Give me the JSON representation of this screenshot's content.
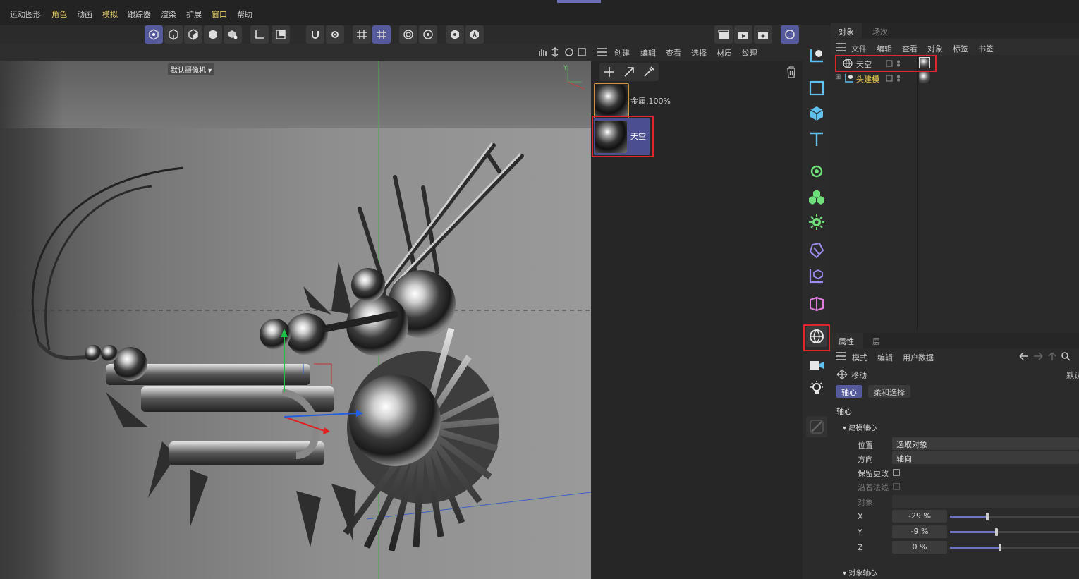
{
  "menu": [
    "运动图形",
    "角色",
    "动画",
    "模拟",
    "跟踪器",
    "渲染",
    "扩展",
    "窗口",
    "帮助"
  ],
  "viewport": {
    "camera_label": "默认摄像机",
    "axis_y": "Y"
  },
  "material_panel": {
    "menu": [
      "创建",
      "编辑",
      "查看",
      "选择",
      "材质",
      "纹理"
    ],
    "materials": [
      {
        "name": "金属.100%"
      },
      {
        "name": "天空",
        "selected": true
      }
    ]
  },
  "object_panel": {
    "tabs": [
      "对象",
      "场次"
    ],
    "menu": [
      "文件",
      "编辑",
      "查看",
      "对象",
      "标签",
      "书签"
    ],
    "objects": [
      {
        "name": "天空",
        "color": "#c9c9c9"
      },
      {
        "name": "头建模",
        "color": "#e8c24a"
      }
    ]
  },
  "attribute_panel": {
    "tabs": [
      "属性",
      "层"
    ],
    "menu": [
      "模式",
      "编辑",
      "用户数据"
    ],
    "tool_name": "移动",
    "right_label": "默认",
    "subtabs": [
      "轴心",
      "柔和选择"
    ],
    "section_title": "轴心",
    "group1": "建模轴心",
    "rows": {
      "position": {
        "label": "位置",
        "value": "选取对象"
      },
      "direction": {
        "label": "方向",
        "value": "轴向"
      },
      "keep_changes": {
        "label": "保留更改"
      },
      "along_normal": {
        "label": "沿着法线"
      },
      "object": {
        "label": "对象"
      }
    },
    "axes": [
      {
        "label": "X",
        "value": "-29 %",
        "fraction": 0.29
      },
      {
        "label": "Y",
        "value": "-9 %",
        "fraction": 0.36
      },
      {
        "label": "Z",
        "value": "0 %",
        "fraction": 0.39
      }
    ],
    "group2": "对象轴心"
  },
  "colors": {
    "accent": "#545a9c",
    "highlight_box": "#e0252c",
    "menu_highlight": "#e8d06a"
  }
}
